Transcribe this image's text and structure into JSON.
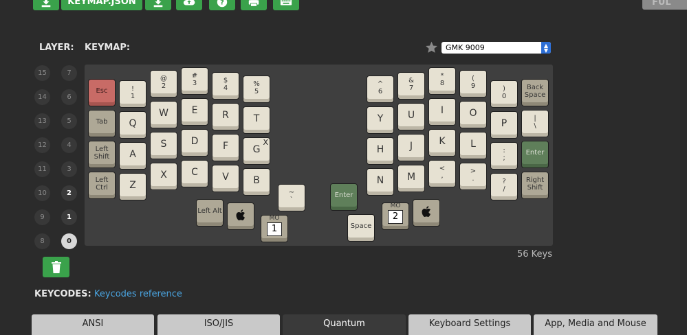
{
  "toolbar": {
    "keymap_json_label": "KEYMAP.JSON",
    "full_label": "FUL"
  },
  "labels": {
    "layer": "LAYER:",
    "keymap": "KEYMAP:",
    "keycodes": "KEYCODES:",
    "keycodes_link": "Keycodes reference",
    "key_count": "56 Keys"
  },
  "keyset": {
    "selected": "GMK 9009"
  },
  "layers": {
    "left": [
      "15",
      "14",
      "13",
      "12",
      "11",
      "10",
      "9",
      "8"
    ],
    "right": [
      "7",
      "6",
      "5",
      "4",
      "3",
      "2",
      "1",
      "0"
    ]
  },
  "keys": {
    "esc": "Esc",
    "n1_top": "!",
    "n1_bot": "1",
    "n2_top": "@",
    "n2_bot": "2",
    "n3_top": "#",
    "n3_bot": "3",
    "n4_top": "$",
    "n4_bot": "4",
    "n5_top": "%",
    "n5_bot": "5",
    "n6_top": "^",
    "n6_bot": "6",
    "n7_top": "&",
    "n7_bot": "7",
    "n8_top": "*",
    "n8_bot": "8",
    "n9_top": "(",
    "n9_bot": "9",
    "n0_top": ")",
    "n0_bot": "0",
    "backspace_1": "Back",
    "backspace_2": "Space",
    "tab": "Tab",
    "q": "Q",
    "w": "W",
    "e": "E",
    "r": "R",
    "t": "T",
    "y": "Y",
    "u": "U",
    "i": "I",
    "o": "O",
    "p": "P",
    "pipe_top": "|",
    "pipe_bot": "\\",
    "lshift_1": "Left",
    "lshift_2": "Shift",
    "a": "A",
    "s": "S",
    "d": "D",
    "f": "F",
    "g": "G",
    "g_mark": "X",
    "h": "H",
    "j": "J",
    "k": "K",
    "l": "L",
    "semi_top": ":",
    "semi_bot": ";",
    "enter_right": "Enter",
    "lctrl_1": "Left",
    "lctrl_2": "Ctrl",
    "z": "Z",
    "x": "X",
    "c": "C",
    "v": "V",
    "b": "B",
    "n": "N",
    "m": "M",
    "comma_top": "<",
    "comma_bot": ",",
    "period_top": ">",
    "period_bot": ".",
    "slash_top": "?",
    "slash_bot": "/",
    "rshift_1": "Right",
    "rshift_2": "Shift",
    "lalt": "Left Alt",
    "grave_top": "~",
    "grave_bot": "`",
    "enter_thumb": "Enter",
    "space": "Space",
    "mo_label": "MO",
    "mo1": "1",
    "mo2": "2"
  },
  "tabs": [
    "ANSI",
    "ISO/JIS",
    "Quantum",
    "Keyboard Settings",
    "App, Media and Mouse"
  ]
}
